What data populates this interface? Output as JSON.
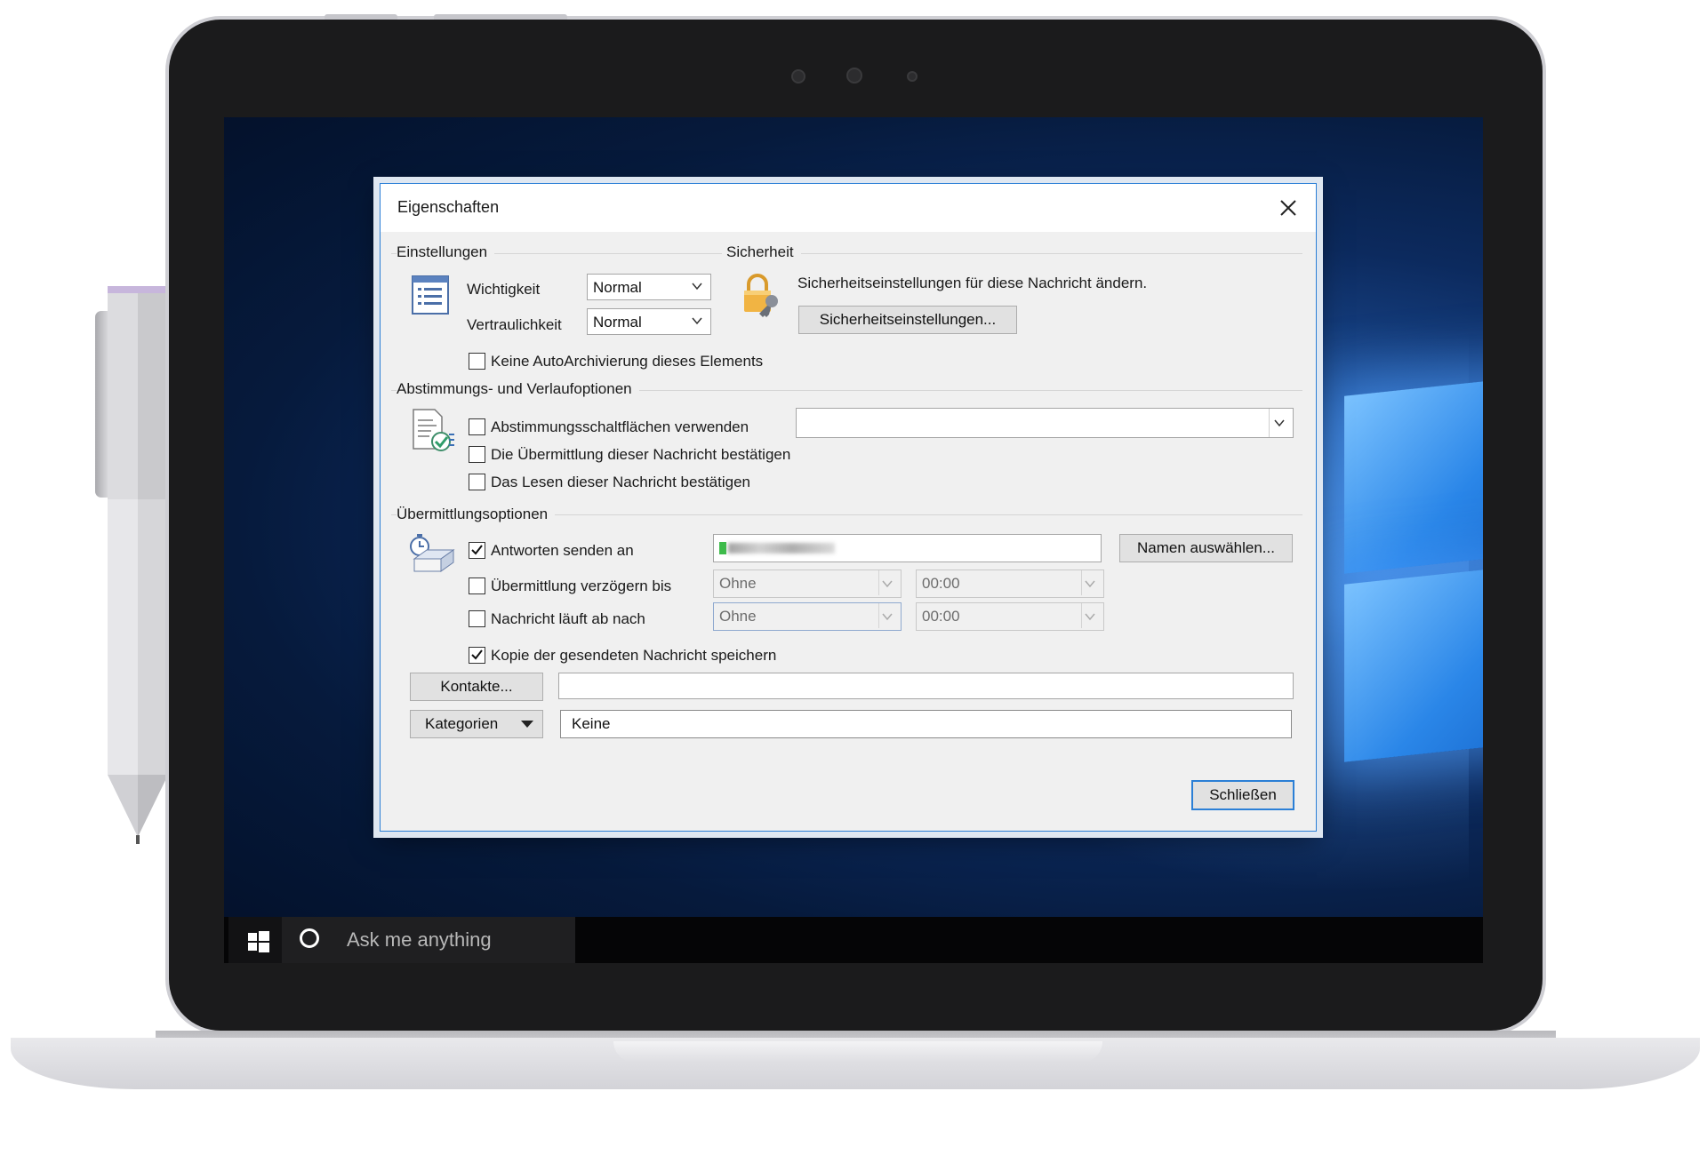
{
  "taskbar": {
    "search_placeholder": "Ask me anything",
    "start_icon": "windows-logo-icon",
    "cortana_icon": "cortana-ring-icon"
  },
  "dialog": {
    "title": "Eigenschaften",
    "close_icon": "close-icon",
    "einstellungen": {
      "section_label": "Einstellungen",
      "wichtigkeit_label": "Wichtigkeit",
      "wichtigkeit_value": "Normal",
      "vertraulichkeit_label": "Vertraulichkeit",
      "vertraulichkeit_value": "Normal",
      "autoarchive_label": "Keine AutoArchivierung dieses Elements",
      "autoarchive_checked": false
    },
    "sicherheit": {
      "section_label": "Sicherheit",
      "description": "Sicherheitseinstellungen für diese Nachricht ändern.",
      "button_label": "Sicherheitseinstellungen..."
    },
    "abstimmung": {
      "section_label": "Abstimmungs- und Verlaufoptionen",
      "voting_buttons_label": "Abstimmungsschaltflächen verwenden",
      "voting_buttons_checked": false,
      "voting_buttons_value": "",
      "delivery_receipt_label": "Die Übermittlung dieser Nachricht bestätigen",
      "delivery_receipt_checked": false,
      "read_receipt_label": "Das Lesen dieser Nachricht bestätigen",
      "read_receipt_checked": false
    },
    "uebermittlung": {
      "section_label": "Übermittlungsoptionen",
      "reply_to_label": "Antworten senden an",
      "reply_to_checked": true,
      "names_button_label": "Namen auswählen...",
      "delay_label": "Übermittlung verzögern bis",
      "delay_checked": false,
      "delay_date": "Ohne",
      "delay_time": "00:00",
      "expires_label": "Nachricht läuft ab nach",
      "expires_checked": false,
      "expires_date": "Ohne",
      "expires_time": "00:00",
      "save_copy_label": "Kopie der gesendeten Nachricht speichern",
      "save_copy_checked": true
    },
    "contacts_button_label": "Kontakte...",
    "contacts_value": "",
    "categories_button_label": "Kategorien",
    "categories_value": "Keine",
    "close_button_label": "Schließen"
  }
}
